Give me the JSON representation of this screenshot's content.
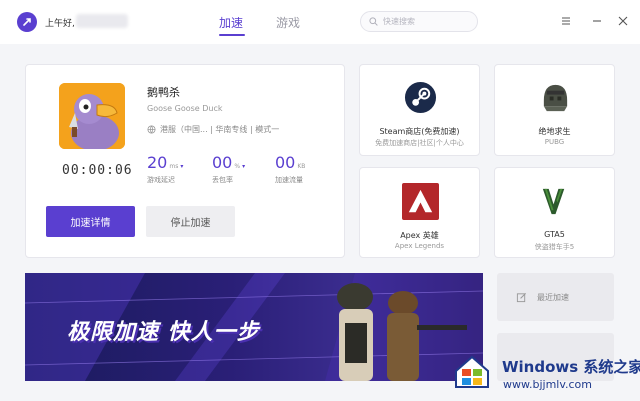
{
  "header": {
    "greeting": "上午好,",
    "tabs": [
      {
        "label": "加速",
        "active": true
      },
      {
        "label": "游戏",
        "active": false
      }
    ],
    "search_placeholder": "快速搜索"
  },
  "current_game": {
    "name": "鹅鸭杀",
    "english_name": "Goose Goose Duck",
    "server": "港服（中国... | 华南专线 | 模式一",
    "timer": "00:00:06",
    "stats": [
      {
        "value": "20",
        "unit": "ms",
        "label": "游戏延迟"
      },
      {
        "value": "00",
        "unit": "%",
        "label": "丢包率"
      },
      {
        "value": "00",
        "unit": "KB",
        "label": "加速流量"
      }
    ],
    "detail_button": "加速详情",
    "stop_button": "停止加速"
  },
  "game_tiles": [
    {
      "title": "Steam商店(免费加速)",
      "subtitle": "免费加速商店|社区|个人中心",
      "icon": "steam-icon"
    },
    {
      "title": "绝地求生",
      "subtitle": "PUBG",
      "icon": "pubg-helmet-icon"
    },
    {
      "title": "Apex 英雄",
      "subtitle": "Apex Legends",
      "icon": "apex-icon"
    },
    {
      "title": "GTA5",
      "subtitle": "侠盗猎车手5",
      "icon": "gta5-icon"
    }
  ],
  "banner": {
    "text": "极限加速 快人一步"
  },
  "side": {
    "recent_label": "最近加速"
  },
  "watermark": {
    "title": "Windows 系统之家",
    "url": "www.bjjmlv.com"
  },
  "colors": {
    "accent": "#5a3fd0",
    "background": "#f4f5f8"
  }
}
